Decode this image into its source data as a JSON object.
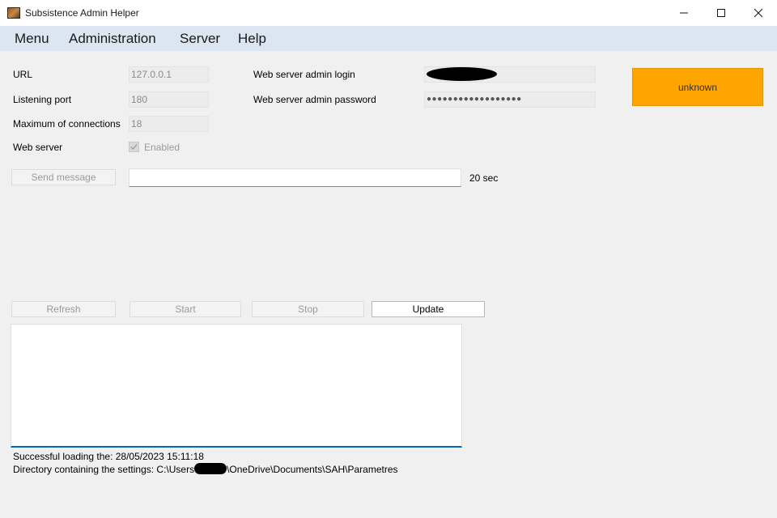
{
  "window": {
    "title": "Subsistence Admin Helper",
    "icon": "app-icon"
  },
  "menu": [
    "Menu",
    "Administration",
    "Server",
    "Help"
  ],
  "form": {
    "url_label": "URL",
    "url_value": "127.0.0.1",
    "port_label": "Listening port",
    "port_value": "180",
    "maxconn_label": "Maximum of connections",
    "maxconn_value": "18",
    "webserver_label": "Web server",
    "webserver_checkbox_label": "Enabled",
    "webserver_checked": true,
    "admin_login_label": "Web server admin login",
    "admin_password_label": "Web server admin password",
    "admin_password_value": "●●●●●●●●●●●●●●●●●●"
  },
  "status": {
    "text": "unknown",
    "color": "#ffa500"
  },
  "message": {
    "button_label": "Send message",
    "input_value": "",
    "duration": "20 sec"
  },
  "actions": {
    "refresh": "Refresh",
    "start": "Start",
    "stop": "Stop",
    "update": "Update"
  },
  "footer": {
    "loading": "Successful loading the: 28/05/2023 15:11:18",
    "settings_prefix": "Directory containing the settings: C:\\Users",
    "settings_suffix": "\\OneDrive\\Documents\\SAH\\Parametres"
  },
  "colors": {
    "accent": "#0067c0",
    "menubar": "#dbe6f2"
  }
}
